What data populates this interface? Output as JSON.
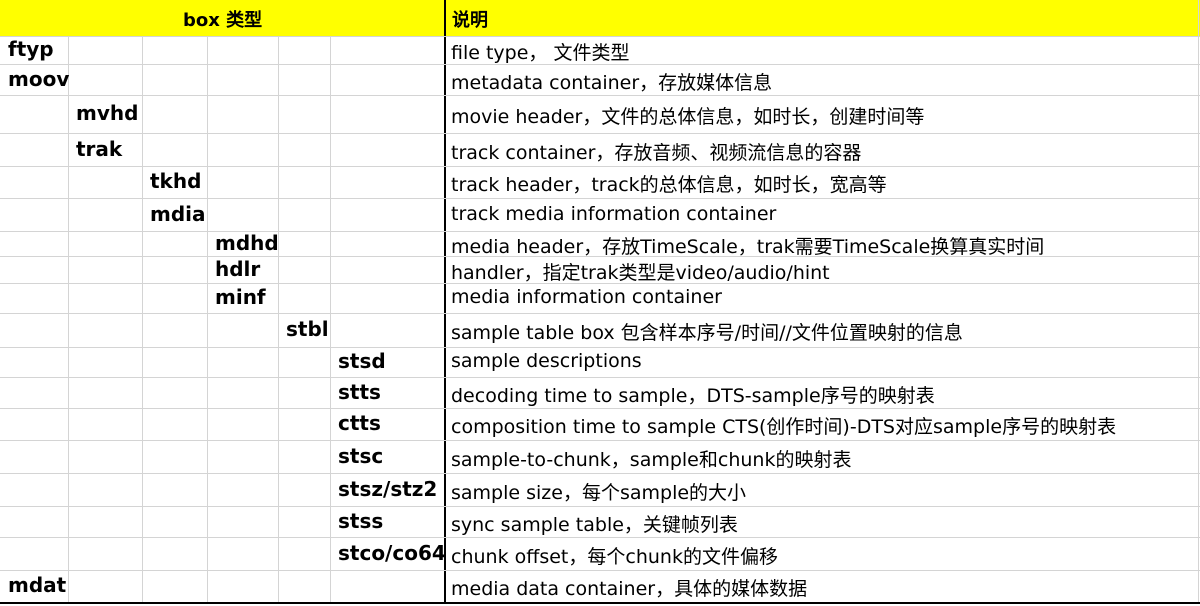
{
  "header": {
    "box_type": "box 类型",
    "description": "说明",
    "fill_color": "#ffff00"
  },
  "rows": [
    {
      "level": 0,
      "box": "ftyp",
      "description": "file type， 文件类型"
    },
    {
      "level": 0,
      "box": "moov",
      "description": "metadata container，存放媒体信息"
    },
    {
      "level": 1,
      "box": "mvhd",
      "description": "movie header，文件的总体信息，如时长，创建时间等"
    },
    {
      "level": 1,
      "box": "trak",
      "description": "track container，存放音频、视频流信息的容器"
    },
    {
      "level": 2,
      "box": "tkhd",
      "description": "track header，track的总体信息，如时长，宽高等"
    },
    {
      "level": 2,
      "box": "mdia",
      "description": "track media information container"
    },
    {
      "level": 3,
      "box": "mdhd",
      "description": "media header，存放TimeScale，trak需要TimeScale换算真实时间"
    },
    {
      "level": 3,
      "box": "hdlr",
      "description": "handler，指定trak类型是video/audio/hint"
    },
    {
      "level": 3,
      "box": "minf",
      "description": "media information container"
    },
    {
      "level": 4,
      "box": "stbl",
      "description": "sample table box 包含样本序号/时间//文件位置映射的信息"
    },
    {
      "level": 5,
      "box": "stsd",
      "description": "sample descriptions"
    },
    {
      "level": 5,
      "box": "stts",
      "description": "decoding time to sample，DTS-sample序号的映射表"
    },
    {
      "level": 5,
      "box": "ctts",
      "description": "composition time to sample CTS(创作时间)-DTS对应sample序号的映射表"
    },
    {
      "level": 5,
      "box": "stsc",
      "description": "sample-to-chunk，sample和chunk的映射表"
    },
    {
      "level": 5,
      "box": "stsz/stz2",
      "description": "sample size，每个sample的大小"
    },
    {
      "level": 5,
      "box": "stss",
      "description": "sync sample table，关键帧列表"
    },
    {
      "level": 5,
      "box": "stco/co64",
      "description": "chunk offset，每个chunk的文件偏移"
    },
    {
      "level": 0,
      "box": "mdat",
      "description": "media data container，具体的媒体数据"
    }
  ]
}
